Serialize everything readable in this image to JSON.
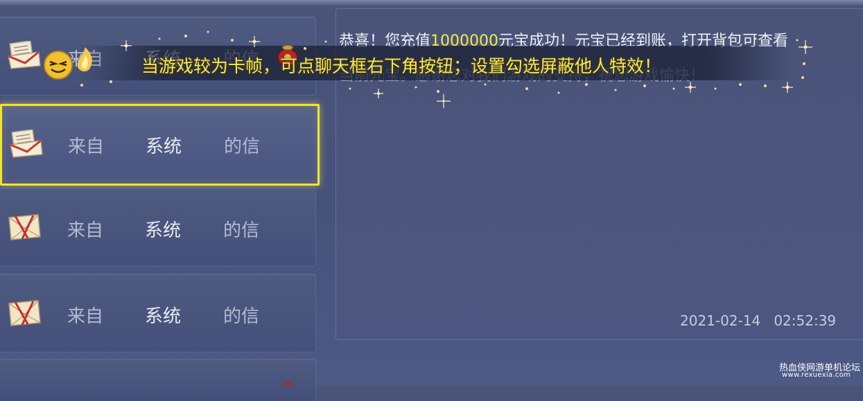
{
  "mail_list": {
    "items": [
      {
        "from_prefix": "来自",
        "sender": "系统",
        "suffix": "的信",
        "state": "opened"
      },
      {
        "from_prefix": "来自",
        "sender": "系统",
        "suffix": "的信",
        "state": "opened",
        "selected": true
      },
      {
        "from_prefix": "来自",
        "sender": "系统",
        "suffix": "的信",
        "state": "unread"
      },
      {
        "from_prefix": "来自",
        "sender": "系统",
        "suffix": "的信",
        "state": "unread"
      }
    ]
  },
  "message": {
    "line1_pre": "恭喜！您充值",
    "amount": "1000000",
    "line1_post": "元宝成功！元宝已经到账，打开背包可查看",
    "line2": "当前元宝。感谢您对我们游戏的支持，祝您游戏愉快！",
    "date": "2021-02-14",
    "time": "02:52:39"
  },
  "notice": {
    "text": "当游戏较为卡帧，可点聊天框右下角按钮；设置勾选屏蔽他人特效！"
  },
  "watermark": {
    "line1": "热血侠网游单机论坛",
    "line2": "www.rexuexia.com"
  },
  "colors": {
    "accent_yellow": "#f2e52b",
    "amount_yellow": "#f4ea4a",
    "panel_bg": "#4a5478"
  },
  "icons": [
    "envelope-opened-icon",
    "envelope-gift-icon",
    "smiley-emoji-icon",
    "money-pouch-icon",
    "sparkle-effect"
  ]
}
